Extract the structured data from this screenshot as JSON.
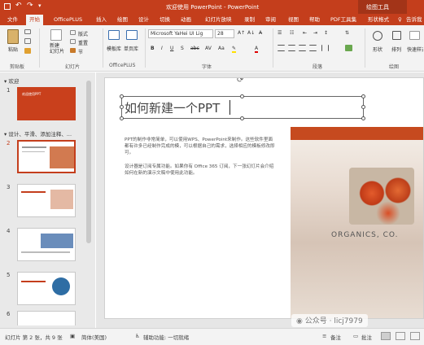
{
  "titlebar": {
    "title": "欢迎使用 PowerPoint  -  PowerPoint",
    "drawing_tools": "绘图工具"
  },
  "tabs": [
    "文件",
    "开始",
    "OfficePLUS",
    "插入",
    "绘图",
    "设计",
    "切换",
    "动画",
    "幻灯片放映",
    "录制",
    "审阅",
    "视图",
    "帮助",
    "PDF工具集",
    "形状格式",
    "告诉我"
  ],
  "ribbon": {
    "paste": "粘贴",
    "new_slide": "新建\n幻灯片",
    "layout": "版式",
    "reset": "重置",
    "section": "节",
    "template_lib": "模板库",
    "single_page_lib": "单页库",
    "font_name": "Microsoft YaHei UI Lig",
    "font_size": "28",
    "shape": "形状",
    "arrange": "排列",
    "quick_styles": "快速样式",
    "groups": [
      "剪贴板",
      "幻灯片",
      "OfficePLUS",
      "字体",
      "段落",
      "绘图"
    ]
  },
  "slides_pane": {
    "sections": [
      "欢迎",
      "设计、平滑、添加注释、..."
    ],
    "numbers": [
      "1",
      "2",
      "3",
      "4",
      "5",
      "6"
    ],
    "thumb1_text": "欢迎使用PPT"
  },
  "slide": {
    "title": "如何新建一个PPT",
    "para1": "PPT的制作非常简单，可以使用WPS、PowerPoint来制作。这些软件里面都有许多已经制作完成的模，可以根据自己的需求，选择相应的模板修改即可。",
    "para2": "设计器是订阅专属功能。如果你有 Office 365 订阅，下一张幻灯片会介绍如何在新的演示文稿中使用此功能。",
    "brand": "ORGANICS, CO."
  },
  "statusbar": {
    "slide_count": "幻灯片 第 2 张，共 9 张",
    "language": "简体(美国)",
    "accessibility": "辅助功能: 一切就绪",
    "notes": "备注",
    "comments": "批注"
  },
  "watermark": "公众号 · licj7979"
}
